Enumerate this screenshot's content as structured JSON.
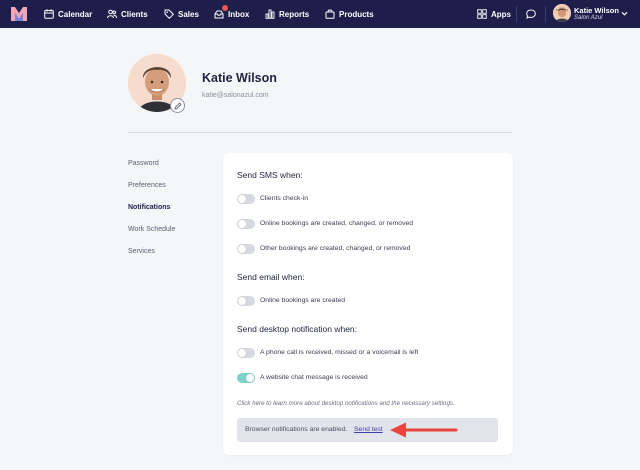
{
  "nav": {
    "items": [
      {
        "label": "Calendar",
        "icon": "calendar-icon"
      },
      {
        "label": "Clients",
        "icon": "clients-icon"
      },
      {
        "label": "Sales",
        "icon": "tag-icon"
      },
      {
        "label": "Inbox",
        "icon": "inbox-icon"
      },
      {
        "label": "Reports",
        "icon": "bar-chart-icon"
      },
      {
        "label": "Products",
        "icon": "bag-icon"
      }
    ],
    "apps_label": "Apps",
    "user": {
      "name": "Katie Wilson",
      "salon": "Salon Azul"
    }
  },
  "profile": {
    "name": "Katie Wilson",
    "email": "katie@salonazul.com"
  },
  "side_menu": [
    {
      "label": "Password",
      "active": false
    },
    {
      "label": "Preferences",
      "active": false
    },
    {
      "label": "Notifications",
      "active": true
    },
    {
      "label": "Work Schedule",
      "active": false
    },
    {
      "label": "Services",
      "active": false
    }
  ],
  "notifications": {
    "sms_title": "Send SMS when:",
    "sms": [
      {
        "label": "Clients check-in",
        "on": false
      },
      {
        "label": "Online bookings are created, changed, or removed",
        "on": false
      },
      {
        "label": "Other bookings are created, changed, or removed",
        "on": false
      }
    ],
    "email_title": "Send email when:",
    "email": [
      {
        "label": "Online bookings are created",
        "on": false
      }
    ],
    "desktop_title": "Send desktop notification when:",
    "desktop": [
      {
        "label": "A phone call is received, missed or a voicemail is left",
        "on": false
      },
      {
        "label": "A website chat message is received",
        "on": true
      }
    ],
    "help_text": "Click here to learn more about desktop notifications and the necessary settings.",
    "banner_text": "Browser notifications are enabled.",
    "send_test": "Send test"
  },
  "colors": {
    "nav_bg": "#1d1f4a",
    "toggle_on": "#7fd1cb",
    "arrow": "#e8453c",
    "badge": "#e8565a"
  }
}
